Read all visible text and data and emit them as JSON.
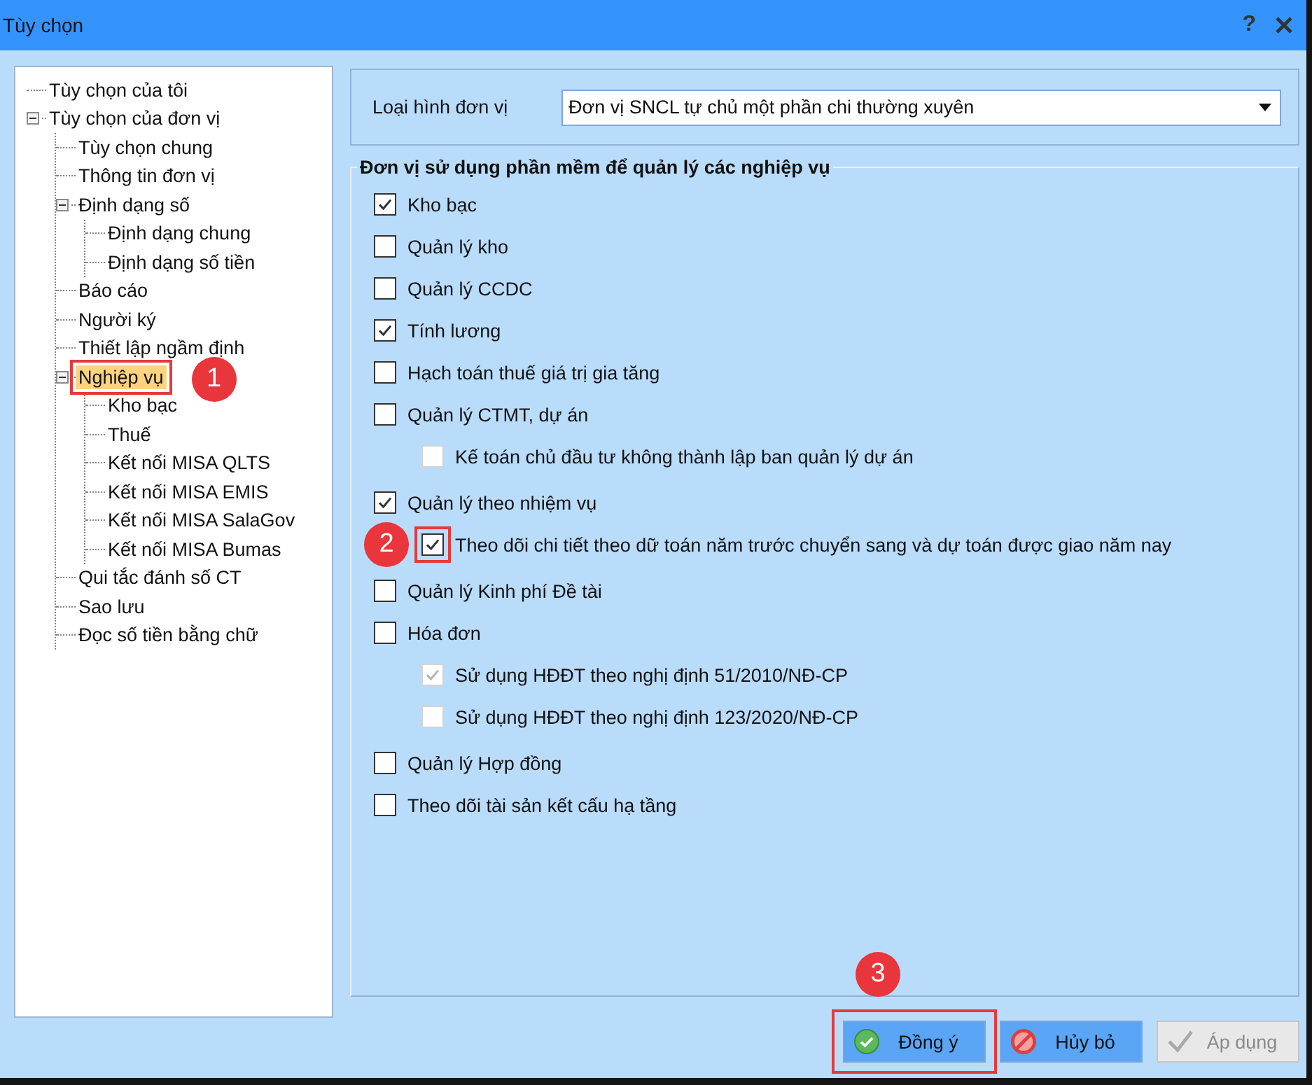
{
  "window": {
    "title": "Tùy chọn",
    "help_label": "?"
  },
  "tree": [
    {
      "label": "Tùy chọn của tôi",
      "selected": false
    },
    {
      "label": "Tùy chọn của đơn vị",
      "selected": false,
      "expanded": true,
      "children": [
        {
          "label": "Tùy chọn chung",
          "selected": false
        },
        {
          "label": "Thông tin đơn vị",
          "selected": false
        },
        {
          "label": "Định dạng số",
          "selected": false,
          "expanded": true,
          "children": [
            {
              "label": "Định dạng chung",
              "selected": false
            },
            {
              "label": "Định dạng số tiền",
              "selected": false
            }
          ]
        },
        {
          "label": "Báo cáo",
          "selected": false
        },
        {
          "label": "Người ký",
          "selected": false
        },
        {
          "label": "Thiết lập ngầm định",
          "selected": false
        },
        {
          "label": "Nghiệp vụ",
          "selected": true,
          "highlighted": true,
          "callout": "1",
          "expanded": true,
          "children": [
            {
              "label": "Kho bạc",
              "selected": false
            },
            {
              "label": "Thuế",
              "selected": false
            },
            {
              "label": "Kết nối MISA QLTS",
              "selected": false
            },
            {
              "label": "Kết nối MISA EMIS",
              "selected": false
            },
            {
              "label": "Kết nối MISA SalaGov",
              "selected": false
            },
            {
              "label": "Kết nối MISA Bumas",
              "selected": false
            }
          ]
        },
        {
          "label": "Qui tắc đánh số CT",
          "selected": false
        },
        {
          "label": "Sao lưu",
          "selected": false
        },
        {
          "label": "Đọc số tiền bằng chữ",
          "selected": false
        }
      ]
    }
  ],
  "unit_type": {
    "label": "Loại hình đơn vị",
    "value": "Đơn vị SNCL tự chủ một phần chi thường xuyên"
  },
  "group": {
    "title": "Đơn vị sử dụng phần mềm để quản lý các nghiệp vụ",
    "options": [
      {
        "label": "Kho bạc",
        "checked": true,
        "disabled": false
      },
      {
        "label": "Quản lý kho",
        "checked": false,
        "disabled": false
      },
      {
        "label": "Quản lý CCDC",
        "checked": false,
        "disabled": false
      },
      {
        "label": "Tính lương",
        "checked": true,
        "disabled": false
      },
      {
        "label": "Hạch toán thuế giá trị gia tăng",
        "checked": false,
        "disabled": false
      },
      {
        "label": "Quản lý CTMT, dự án",
        "checked": false,
        "disabled": false,
        "children": [
          {
            "label": "Kế toán chủ đầu tư không thành lập ban quản lý dự án",
            "checked": false,
            "disabled": true
          }
        ]
      },
      {
        "label": "Quản lý theo nhiệm vụ",
        "checked": true,
        "disabled": false,
        "children": [
          {
            "label": "Theo dõi chi tiết theo dữ toán năm trước chuyển sang và dự toán được giao năm nay",
            "checked": true,
            "disabled": false,
            "highlighted": true,
            "callout": "2"
          }
        ]
      },
      {
        "label": "Quản lý Kinh phí Đề tài",
        "checked": false,
        "disabled": false
      },
      {
        "label": "Hóa đơn",
        "checked": false,
        "disabled": false,
        "children": [
          {
            "label": "Sử dụng HĐĐT theo nghị định 51/2010/NĐ-CP",
            "checked": true,
            "disabled": true
          },
          {
            "label": "Sử dụng HĐĐT theo nghị định 123/2020/NĐ-CP",
            "checked": false,
            "disabled": true
          }
        ]
      },
      {
        "label": "Quản lý Hợp đồng",
        "checked": false,
        "disabled": false
      },
      {
        "label": "Theo dõi tài sản kết cấu hạ tầng",
        "checked": false,
        "disabled": false
      }
    ]
  },
  "buttons": [
    {
      "kind": "ok",
      "label": "Đồng ý",
      "disabled": false,
      "highlighted": true,
      "callout": "3"
    },
    {
      "kind": "cancel",
      "label": "Hủy bỏ",
      "disabled": false
    },
    {
      "kind": "apply",
      "label": "Áp dụng",
      "disabled": true
    }
  ]
}
